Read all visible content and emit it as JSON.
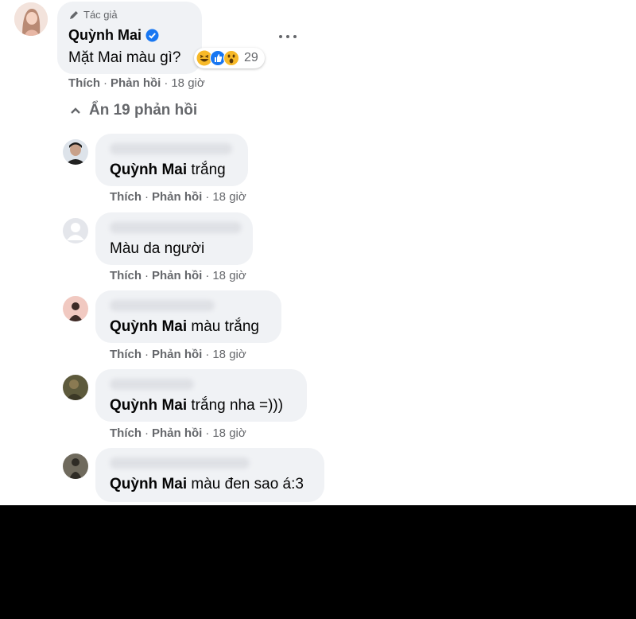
{
  "main_comment": {
    "author_badge": "Tác giả",
    "author": "Quỳnh Mai",
    "text": "Mặt Mai màu gì?",
    "reaction_count": "29",
    "actions": {
      "like": "Thích",
      "reply": "Phản hồi",
      "time": "18 giờ"
    }
  },
  "toggle": {
    "label": "Ẩn 19 phản hồi"
  },
  "replies": [
    {
      "mention": "Quỳnh Mai",
      "text": " trắng",
      "like": "Thích",
      "reply": "Phản hồi",
      "time": "18 giờ"
    },
    {
      "mention": "",
      "text": "Màu da người",
      "like": "Thích",
      "reply": "Phản hồi",
      "time": "18 giờ"
    },
    {
      "mention": "Quỳnh Mai",
      "text": " màu trắng",
      "like": "Thích",
      "reply": "Phản hồi",
      "time": "18 giờ"
    },
    {
      "mention": "Quỳnh Mai",
      "text": " trắng nha =)))",
      "like": "Thích",
      "reply": "Phản hồi",
      "time": "18 giờ"
    },
    {
      "mention": "Quỳnh Mai",
      "text": " màu đen sao á:3"
    }
  ],
  "colors": {
    "verified": "#1877f2",
    "bubble": "#f0f2f5",
    "meta": "#65676b"
  }
}
